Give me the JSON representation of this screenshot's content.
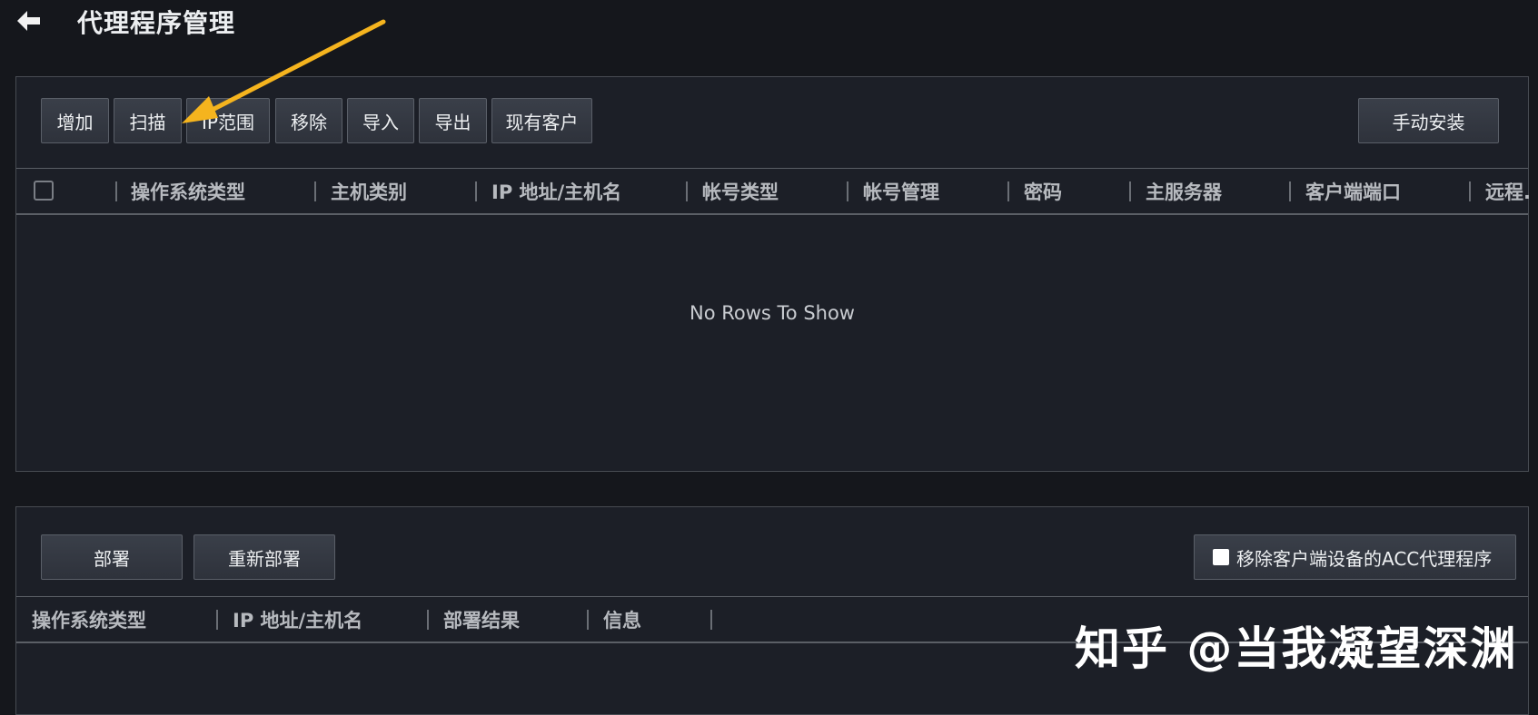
{
  "header": {
    "title": "代理程序管理",
    "back_icon": "arrow-left-icon"
  },
  "agents_panel": {
    "buttons": {
      "add": "增加",
      "scan": "扫描",
      "ip_range": "IP范围",
      "remove": "移除",
      "import": "导入",
      "export": "导出",
      "existing_clients": "现有客户",
      "manual_install": "手动安装"
    },
    "columns": [
      "操作系统类型",
      "主机类别",
      "IP 地址/主机名",
      "帐号类型",
      "帐号管理",
      "密码",
      "主服务器",
      "客户端端口",
      "远程."
    ],
    "empty_message": "No Rows To Show"
  },
  "deploy_panel": {
    "buttons": {
      "deploy": "部署",
      "redeploy": "重新部署",
      "remove_acc": "移除客户端设备的ACC代理程序"
    },
    "columns": [
      "操作系统类型",
      "IP 地址/主机名",
      "部署结果",
      "信息"
    ]
  },
  "annotation": {
    "arrow_color": "#f5b41e"
  },
  "watermark": "知乎 @当我凝望深渊"
}
